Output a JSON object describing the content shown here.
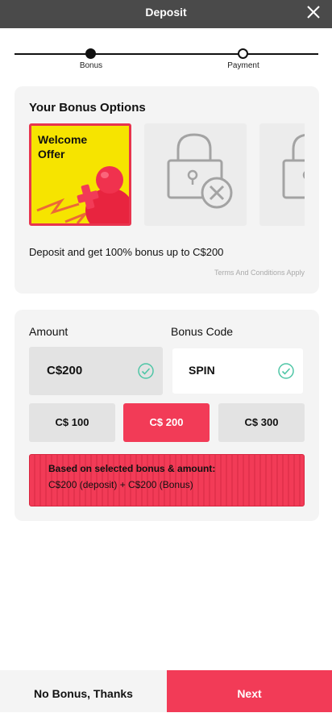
{
  "header": {
    "title": "Deposit",
    "close_icon": "close-icon"
  },
  "stepper": {
    "steps": [
      {
        "label": "Bonus",
        "active": true
      },
      {
        "label": "Payment",
        "active": false
      }
    ]
  },
  "bonus": {
    "heading": "Your Bonus Options",
    "offers": [
      {
        "title": "Welcome Offer",
        "selected": true,
        "icon": "welcome-offer-illustration"
      },
      {
        "title": "",
        "locked": true,
        "icon": "padlock-icon"
      },
      {
        "title": "",
        "locked": true,
        "icon": "padlock-icon"
      }
    ],
    "description": "Deposit and get 100% bonus up to C$200",
    "terms": "Terms And Conditions Apply"
  },
  "amount": {
    "label": "Amount",
    "value": "C$200",
    "code_label": "Bonus Code",
    "code_value": "SPIN",
    "presets": [
      "C$ 100",
      "C$ 200",
      "C$ 300"
    ],
    "selected_preset": "C$ 200",
    "summary_title": "Based on selected bonus & amount:",
    "summary_text": "C$200 (deposit) + C$200 (Bonus)"
  },
  "footer": {
    "no_bonus": "No Bonus, Thanks",
    "next": "Next"
  },
  "colors": {
    "accent": "#f23b57",
    "header_bg": "#4a4a4a",
    "welcome_bg": "#f6e400",
    "check": "#4fc6a6"
  }
}
